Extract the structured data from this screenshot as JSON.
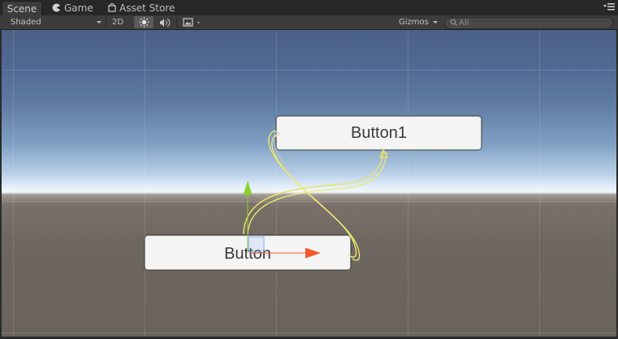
{
  "tabs": [
    {
      "label": "Scene",
      "icon": "none",
      "active": true
    },
    {
      "label": "Game",
      "icon": "pacman-icon",
      "active": false
    },
    {
      "label": "Asset Store",
      "icon": "shopping-bag-icon",
      "active": false
    }
  ],
  "toolbar": {
    "draw_mode": "Shaded",
    "mode_2d_label": "2D",
    "lighting_icon": "sun-icon",
    "audio_icon": "speaker-icon",
    "effects_icon": "image-icon",
    "gizmos_label": "Gizmos",
    "search_placeholder": "All"
  },
  "scene": {
    "buttons": [
      {
        "label": "Button"
      },
      {
        "label": "Button1"
      }
    ]
  },
  "colors": {
    "accent_gizmo_y": "#8bd12a",
    "accent_gizmo_x": "#f4572a",
    "navigation_link": "#e8e06a"
  }
}
